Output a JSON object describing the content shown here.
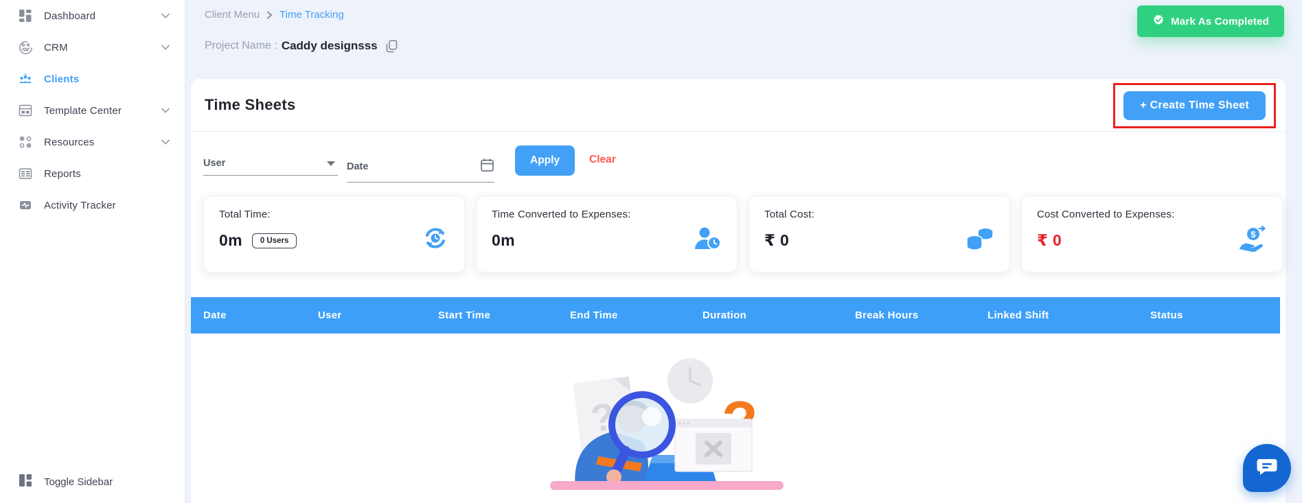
{
  "colors": {
    "accent_blue": "#42a0f6",
    "table_header_blue": "#3d9ff8",
    "success_green": "#2fd180",
    "annotation_red": "#e8211d",
    "clear_red": "#fd594d",
    "value_red": "#e8222d",
    "page_background": "#eef2fb",
    "chat_blue": "#1467d1"
  },
  "sidebar": {
    "items": [
      {
        "label": "Dashboard",
        "icon": "dashboard-icon",
        "expandable": true,
        "active": false
      },
      {
        "label": "CRM",
        "icon": "crm-icon",
        "expandable": true,
        "active": false
      },
      {
        "label": "Clients",
        "icon": "clients-icon",
        "expandable": false,
        "active": true
      },
      {
        "label": "Template Center",
        "icon": "template-center-icon",
        "expandable": true,
        "active": false
      },
      {
        "label": "Resources",
        "icon": "resources-icon",
        "expandable": true,
        "active": false
      },
      {
        "label": "Reports",
        "icon": "reports-icon",
        "expandable": false,
        "active": false
      },
      {
        "label": "Activity Tracker",
        "icon": "activity-tracker-icon",
        "expandable": false,
        "active": false
      }
    ],
    "toggle_label": "Toggle Sidebar"
  },
  "topbar": {
    "breadcrumb": {
      "section": "Client Menu",
      "current": "Time Tracking"
    },
    "project": {
      "label": "Project Name :",
      "name": "Caddy designsss"
    },
    "mark_completed_label": "Mark As Completed"
  },
  "panel": {
    "title": "Time Sheets",
    "create_button_label": "+ Create Time Sheet",
    "filters": {
      "user_placeholder": "User",
      "date_placeholder": "Date",
      "apply_label": "Apply",
      "clear_label": "Clear"
    },
    "stats": [
      {
        "label": "Total Time:",
        "value": "0m",
        "badge": "0 Users",
        "icon": "refresh-time-icon"
      },
      {
        "label": "Time Converted to Expenses:",
        "value": "0m",
        "icon": "user-time-icon"
      },
      {
        "label": "Total Cost:",
        "value": "₹ 0",
        "icon": "coins-icon"
      },
      {
        "label": "Cost Converted to Expenses:",
        "value": "₹ 0",
        "icon": "hand-money-icon"
      }
    ],
    "table": {
      "columns": [
        "Date",
        "User",
        "Start Time",
        "End Time",
        "Duration",
        "Break Hours",
        "Linked Shift",
        "Status"
      ]
    },
    "empty_state": "no-timesheets-illustration"
  }
}
